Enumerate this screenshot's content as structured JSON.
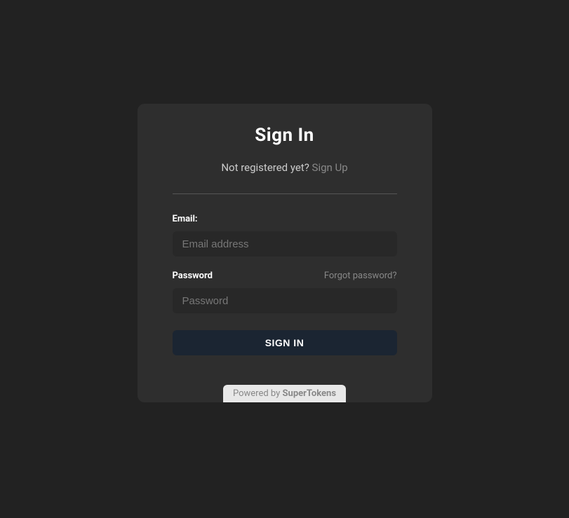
{
  "title": "Sign In",
  "subtitle_text": "Not registered yet? ",
  "signup_link": "Sign Up",
  "email": {
    "label": "Email:",
    "placeholder": "Email address",
    "value": ""
  },
  "password": {
    "label": "Password",
    "forgot_link": "Forgot password?",
    "placeholder": "Password",
    "value": ""
  },
  "signin_button": "SIGN IN",
  "powered_prefix": "Powered by ",
  "powered_brand": "SuperTokens"
}
